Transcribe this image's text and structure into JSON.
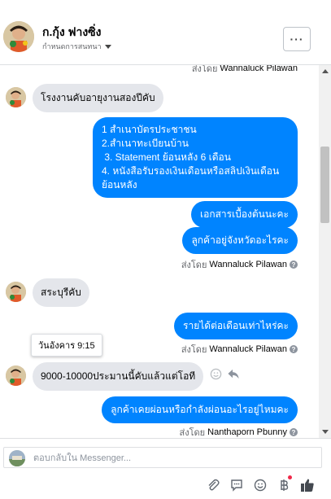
{
  "header": {
    "name": "ก.กุ้ง ฟางซิ่ง",
    "subtitle": "กำหนดการสนทนา",
    "more_label": "···"
  },
  "sent_by_prefix": "ส่งโดย",
  "messages": {
    "top_sent_by_name": "Wannaluck Pilawan",
    "m1": "โรงงานคับอายุงานสองปีคับ",
    "m2_lines": [
      "1 สำเนาบัตรประชาชน",
      "2.สำเนาทะเบียนบ้าน",
      " 3. Statement ย้อนหลัง 6 เดือน",
      "4. หนังสือรับรองเงินเดือนหรือสลิปเงินเดือนย้อนหลัง"
    ],
    "m3": "เอกสารเบื้องต้นนะคะ",
    "m4": "ลูกค้าอยู่จังหวัดอะไรคะ",
    "sent_by_1": "Wannaluck Pilawan",
    "m5": "สระบุรีคับ",
    "m6": "รายได้ต่อเดือนเท่าไหร่คะ",
    "tooltip": "วันอังคาร 9:15",
    "sent_by_2": "Wannaluck Pilawan",
    "m7": "9000-10000ประมานนี้คับแล้วแต่โอที",
    "m8": "ลูกค้าเคยผ่อนหรือกำลังผ่อนอะไรอยู่ไหมคะ",
    "sent_by_3": "Nanthaporn Pbunny"
  },
  "composer": {
    "placeholder": "ตอบกลับใน Messenger..."
  },
  "colors": {
    "outgoing": "#0084ff",
    "incoming": "#e4e6eb",
    "notify_dot": "#f02849"
  },
  "icons": [
    "more-icon",
    "caret-down-icon",
    "help-icon",
    "emoji-react-icon",
    "reply-icon",
    "attach-icon",
    "saved-replies-icon",
    "emoji-icon",
    "payment-icon",
    "like-icon"
  ]
}
